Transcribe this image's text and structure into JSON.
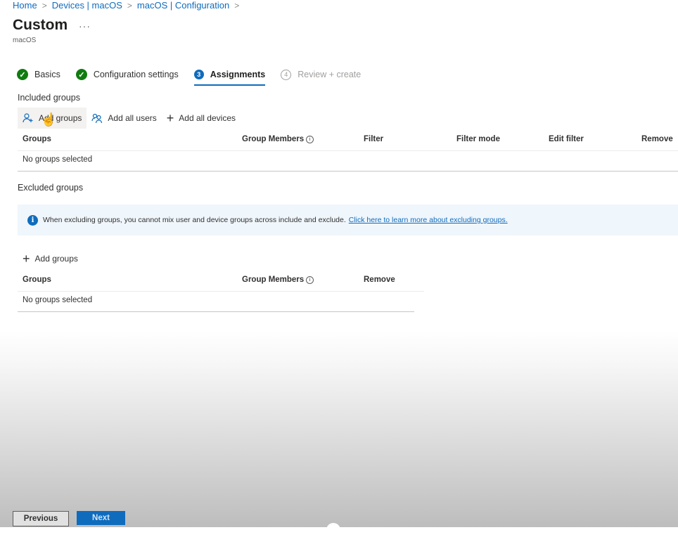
{
  "breadcrumb": [
    "Home",
    "Devices | macOS",
    "macOS | Configuration"
  ],
  "breadcrumb_sep": ">",
  "page": {
    "title": "Custom",
    "more": "···",
    "subtitle": "macOS"
  },
  "steps": [
    {
      "label": "Basics",
      "state": "done",
      "badge": "✓"
    },
    {
      "label": "Configuration settings",
      "state": "done",
      "badge": "✓"
    },
    {
      "label": "Assignments",
      "state": "current",
      "badge": "3"
    },
    {
      "label": "Review + create",
      "state": "todo",
      "badge": "4"
    }
  ],
  "included": {
    "label": "Included groups",
    "commands": {
      "add_groups": "Add groups",
      "add_all_users": "Add all users",
      "add_all_devices": "Add all devices"
    },
    "columns": {
      "groups": "Groups",
      "members": "Group Members",
      "filter": "Filter",
      "filter_mode": "Filter mode",
      "edit_filter": "Edit filter",
      "remove": "Remove"
    },
    "empty": "No groups selected"
  },
  "excluded": {
    "label": "Excluded groups",
    "info_text": "When excluding groups, you cannot mix user and device groups across include and exclude.",
    "info_link": "Click here to learn more about excluding groups.",
    "add_groups": "Add groups",
    "columns": {
      "groups": "Groups",
      "members": "Group Members",
      "remove": "Remove"
    },
    "empty": "No groups selected"
  },
  "footer": {
    "previous": "Previous",
    "next": "Next"
  },
  "colors": {
    "accent": "#0f6cbd",
    "success": "#107c10",
    "info_bg": "#eff6fc"
  }
}
